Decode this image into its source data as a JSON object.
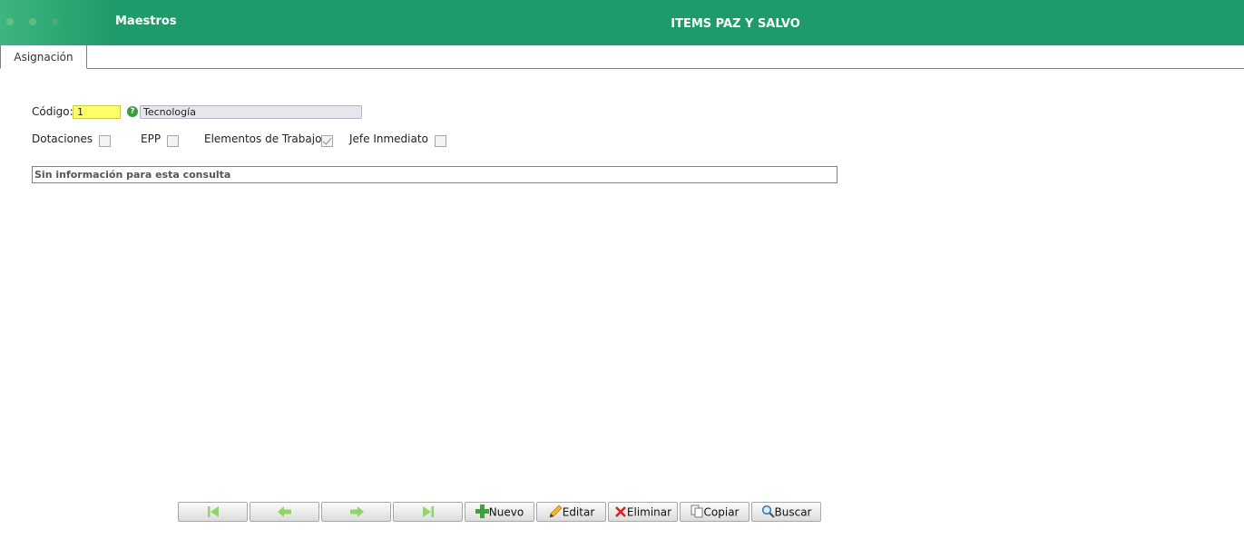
{
  "header": {
    "app_title": "Maestros",
    "window_title": "ITEMS PAZ Y SALVO",
    "bar_color": "#1e9b6a"
  },
  "tabs": [
    {
      "label": "Asignación",
      "active": true
    }
  ],
  "form": {
    "codigo_label": "Código:",
    "codigo_value": "1",
    "help_icon": "question-icon",
    "descripcion_value": "Tecnología",
    "checkboxes": [
      {
        "label": "Dotaciones",
        "checked": false
      },
      {
        "label": "EPP",
        "checked": false
      },
      {
        "label": "Elementos de Trabajo",
        "checked": true
      },
      {
        "label": "Jefe Inmediato",
        "checked": false
      }
    ]
  },
  "grid": {
    "empty_message": "Sin información para esta consulta"
  },
  "toolbar": {
    "first_icon": "first-record-icon",
    "prev_icon": "previous-arrow-icon",
    "next_icon": "next-arrow-icon",
    "last_icon": "last-record-icon",
    "nuevo_label": "Nuevo",
    "editar_label": "Editar",
    "eliminar_label": "Eliminar",
    "copiar_label": "Copiar",
    "buscar_label": "Buscar",
    "nav_icon_color": "#92d36a"
  }
}
